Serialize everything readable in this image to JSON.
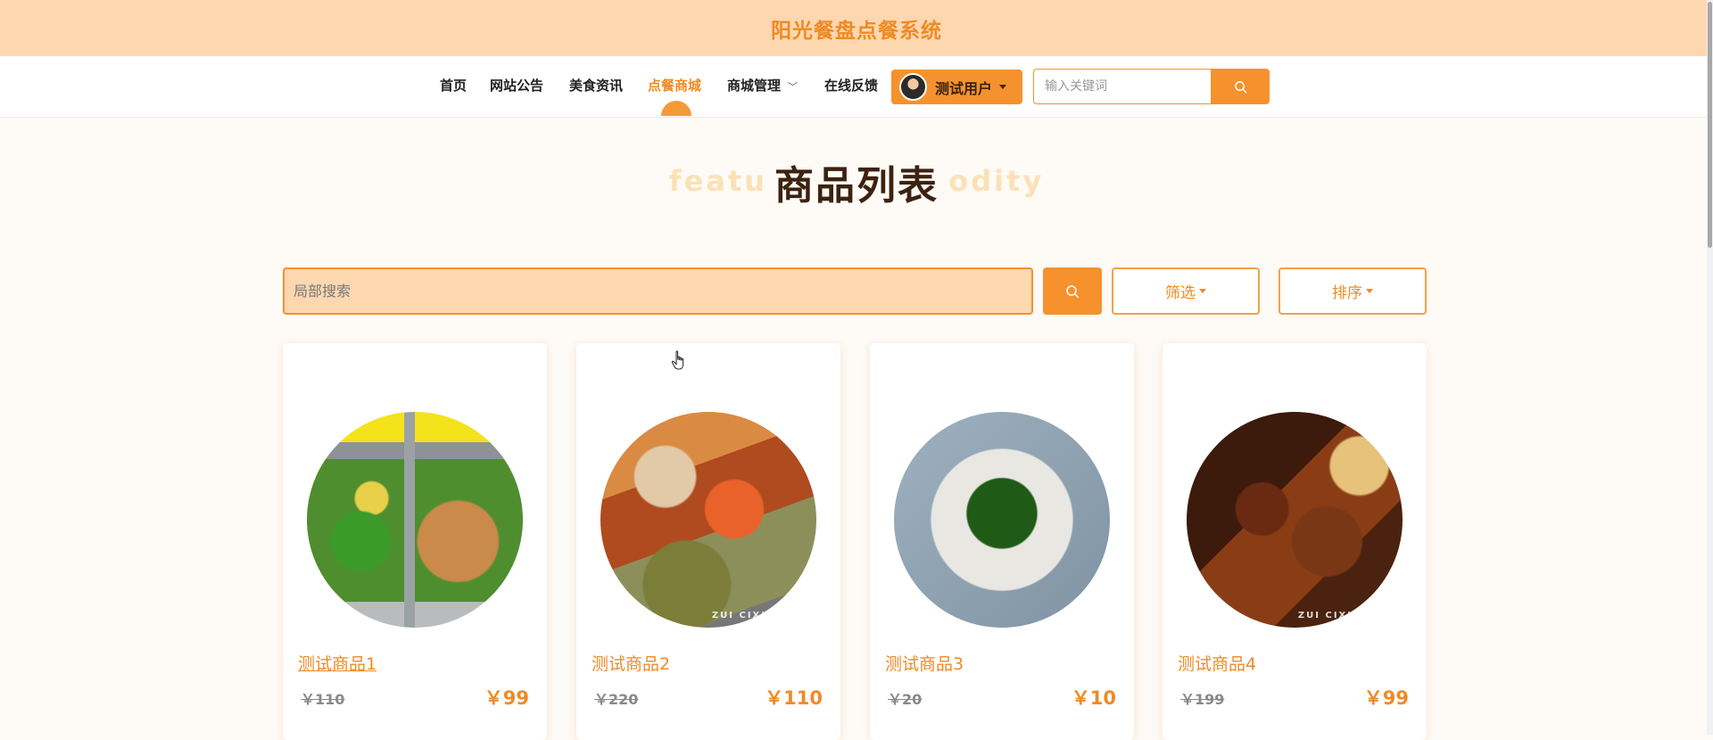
{
  "site": {
    "title": "阳光餐盘点餐系统"
  },
  "nav": {
    "items": [
      {
        "label": "首页"
      },
      {
        "label": "网站公告"
      },
      {
        "label": "美食资讯"
      },
      {
        "label": "点餐商城",
        "active": true
      },
      {
        "label": "商城管理"
      },
      {
        "label": "在线反馈"
      }
    ],
    "user": {
      "name": "测试用户"
    },
    "search": {
      "placeholder": "输入关键词"
    }
  },
  "section": {
    "title": "商品列表",
    "subtitle_en": "featured commodity"
  },
  "filters": {
    "search_placeholder": "局部搜索",
    "filter_label": "筛选",
    "sort_label": "排序"
  },
  "products": [
    {
      "name": "测试商品1",
      "original_price": "￥110",
      "price": "￥99"
    },
    {
      "name": "测试商品2",
      "original_price": "￥220",
      "price": "￥110"
    },
    {
      "name": "测试商品3",
      "original_price": "￥20",
      "price": "￥10"
    },
    {
      "name": "测试商品4",
      "original_price": "￥199",
      "price": "￥99"
    }
  ],
  "watermark": "ZUI CIXI",
  "colors": {
    "accent": "#f5922d",
    "banner": "#fdd7b0",
    "title_dark": "#3d2210"
  }
}
